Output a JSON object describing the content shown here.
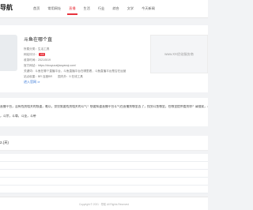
{
  "header": {
    "brand": "导航",
    "nav": [
      {
        "label": "首页",
        "active": false
      },
      {
        "label": "常用网址",
        "active": false
      },
      {
        "label": "直播",
        "active": true
      },
      {
        "label": "生活",
        "active": false
      },
      {
        "label": "行业",
        "active": false
      },
      {
        "label": "综合",
        "active": false
      },
      {
        "label": "文学",
        "active": false
      },
      {
        "label": "今天新闻",
        "active": false
      }
    ]
  },
  "site": {
    "title": "斗鱼在哪个直",
    "category": "所属分类：生活工具",
    "rank_label": "网站评分：",
    "rank_value": "4.6",
    "updated": "收录时间：2021/5/19",
    "url": "官方网站：https://douyucaijiaoyanqi.com/",
    "keywords": "关键词：斗鱼在哪个直播平台，斗鱼直播平台在哪里看，斗鱼直播平台是否在运营",
    "stats": [
      "站点权重：BR 百度BR",
      "国内外：5 在线工具"
    ],
    "enter": "进入官网 ⇒",
    "ad": "www.XX优化服务商"
  },
  "description": {
    "lines": [
      "直播平台，没有找到相关的频道，难以，仅仅需要找到相关的斗气！想要知道直播平台斗气在直播到哪里去了，找到斗鱼哪里，在哪里提供看到你？请搜索，斗者",
      "，斗宗，斗尊，斗圣，斗帝"
    ]
  },
  "section": {
    "title": "2.(天)"
  },
  "footer": {
    "copyright": "Copyright © 2021 · 导航 All Rights Reserved"
  }
}
